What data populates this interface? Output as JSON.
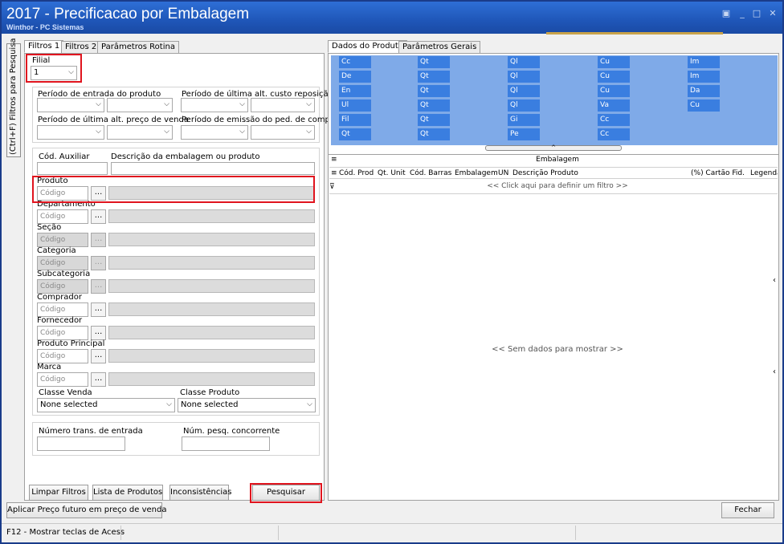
{
  "window": {
    "title": "2017 - Precificacao por Embalagem",
    "subtitle": "Winthor - PC Sistemas",
    "controls": [
      "▣",
      "_",
      "□",
      "✕"
    ]
  },
  "side_tab": "(Ctrl+F) Filtros para Pesquisa",
  "left_tabs": [
    "Filtros 1",
    "Filtros 2",
    "Parâmetros Rotina"
  ],
  "filial": {
    "label": "Filial",
    "value": "1"
  },
  "periods": {
    "entrada": "Período de entrada do produto",
    "custo": "Período de última alt. custo reposição",
    "preco": "Período de última alt. preço de venda",
    "emissao": "Período de emissão do ped. de compra"
  },
  "cod_auxiliar": "Cód. Auxiliar",
  "desc_embalagem": "Descrição da embalagem ou produto",
  "code_placeholder": "Código",
  "dots": "...",
  "lookups": [
    {
      "label": "Produto",
      "enabled": true
    },
    {
      "label": "Departamento",
      "enabled": true
    },
    {
      "label": "Seção",
      "enabled": false
    },
    {
      "label": "Categoria",
      "enabled": false
    },
    {
      "label": "Subcategoria",
      "enabled": false
    },
    {
      "label": "Comprador",
      "enabled": true
    },
    {
      "label": "Fornecedor",
      "enabled": true
    },
    {
      "label": "Produto Principal",
      "enabled": true
    },
    {
      "label": "Marca",
      "enabled": true
    }
  ],
  "classe_venda": {
    "label": "Classe Venda",
    "value": "None selected"
  },
  "classe_produto": {
    "label": "Classe Produto",
    "value": "None selected"
  },
  "num_trans": "Número trans. de entrada",
  "num_pesq": "Núm. pesq. concorrente",
  "left_buttons": [
    "Limpar Filtros",
    "Lista de Produtos",
    "Inconsistências",
    "Pesquisar"
  ],
  "right_tabs": [
    "Dados do Produto",
    "Parâmetros Gerais"
  ],
  "info_cols": [
    [
      "Cc",
      "De",
      "En",
      "Ul",
      "Fil",
      "Qt"
    ],
    [
      "Qt",
      "Qt",
      "Qt",
      "Qt",
      "Qt",
      "Qt"
    ],
    [
      "Ql",
      "Ql",
      "Ql",
      "Ql",
      "Gi",
      "Pe"
    ],
    [
      "Cu",
      "Cu",
      "Cu",
      "Va",
      "Cc",
      "Cc"
    ],
    [
      "Im",
      "Im",
      "Da",
      "Cu"
    ]
  ],
  "grid": {
    "group_label": "Embalagem",
    "columns": [
      "Cód. Prod",
      "Qt. Unit",
      "Cód. Barras",
      "Embalagem",
      "UN",
      "Descrição Produto",
      "(%) Cartão Fid.",
      "Legenda"
    ],
    "filter_hint": "<< Click aqui para definir um filtro >>",
    "empty": "<< Sem dados para mostrar >>"
  },
  "bottom_buttons": {
    "apply": "Aplicar Preço futuro em preço de venda",
    "close": "Fechar"
  },
  "status": "F12 - Mostrar teclas de Acess",
  "colors": {
    "title_bar": "#1f56b8",
    "accent": "#3a7ee0",
    "highlight": "#e0141e"
  }
}
